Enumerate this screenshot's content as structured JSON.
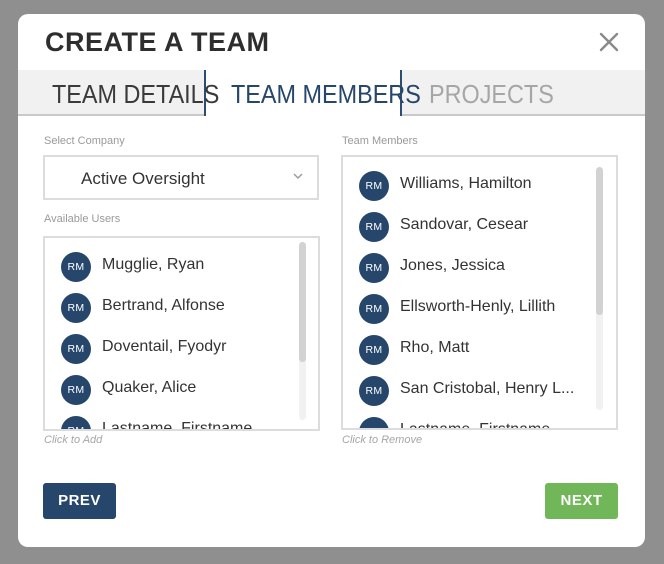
{
  "dialog": {
    "title": "CREATE A TEAM"
  },
  "tabs": [
    {
      "label": "TEAM DETAILS",
      "state": "completed"
    },
    {
      "label": "TEAM MEMBERS",
      "state": "active"
    },
    {
      "label": "PROJECTS",
      "state": "disabled"
    }
  ],
  "company": {
    "label": "Select Company",
    "value": "Active Oversight"
  },
  "available": {
    "label": "Available Users",
    "hint": "Click to Add",
    "users": [
      {
        "initials": "RM",
        "name": "Mugglie, Ryan"
      },
      {
        "initials": "RM",
        "name": "Bertrand, Alfonse"
      },
      {
        "initials": "RM",
        "name": "Doventail, Fyodyr"
      },
      {
        "initials": "RM",
        "name": "Quaker, Alice"
      },
      {
        "initials": "RM",
        "name": "Lastname, Firstname"
      }
    ]
  },
  "members": {
    "label": "Team Members",
    "hint": "Click to Remove",
    "users": [
      {
        "initials": "RM",
        "name": "Williams, Hamilton"
      },
      {
        "initials": "RM",
        "name": "Sandovar, Cesear"
      },
      {
        "initials": "RM",
        "name": "Jones, Jessica"
      },
      {
        "initials": "RM",
        "name": "Ellsworth-Henly, Lillith"
      },
      {
        "initials": "RM",
        "name": "Rho, Matt"
      },
      {
        "initials": "RM",
        "name": "San Cristobal, Henry L..."
      },
      {
        "initials": "RM",
        "name": "Lastname, Firstname"
      }
    ]
  },
  "buttons": {
    "prev": "PREV",
    "next": "NEXT"
  },
  "colors": {
    "primary": "#26476b",
    "success": "#72b65a",
    "overlay": "#8f8f8f"
  }
}
